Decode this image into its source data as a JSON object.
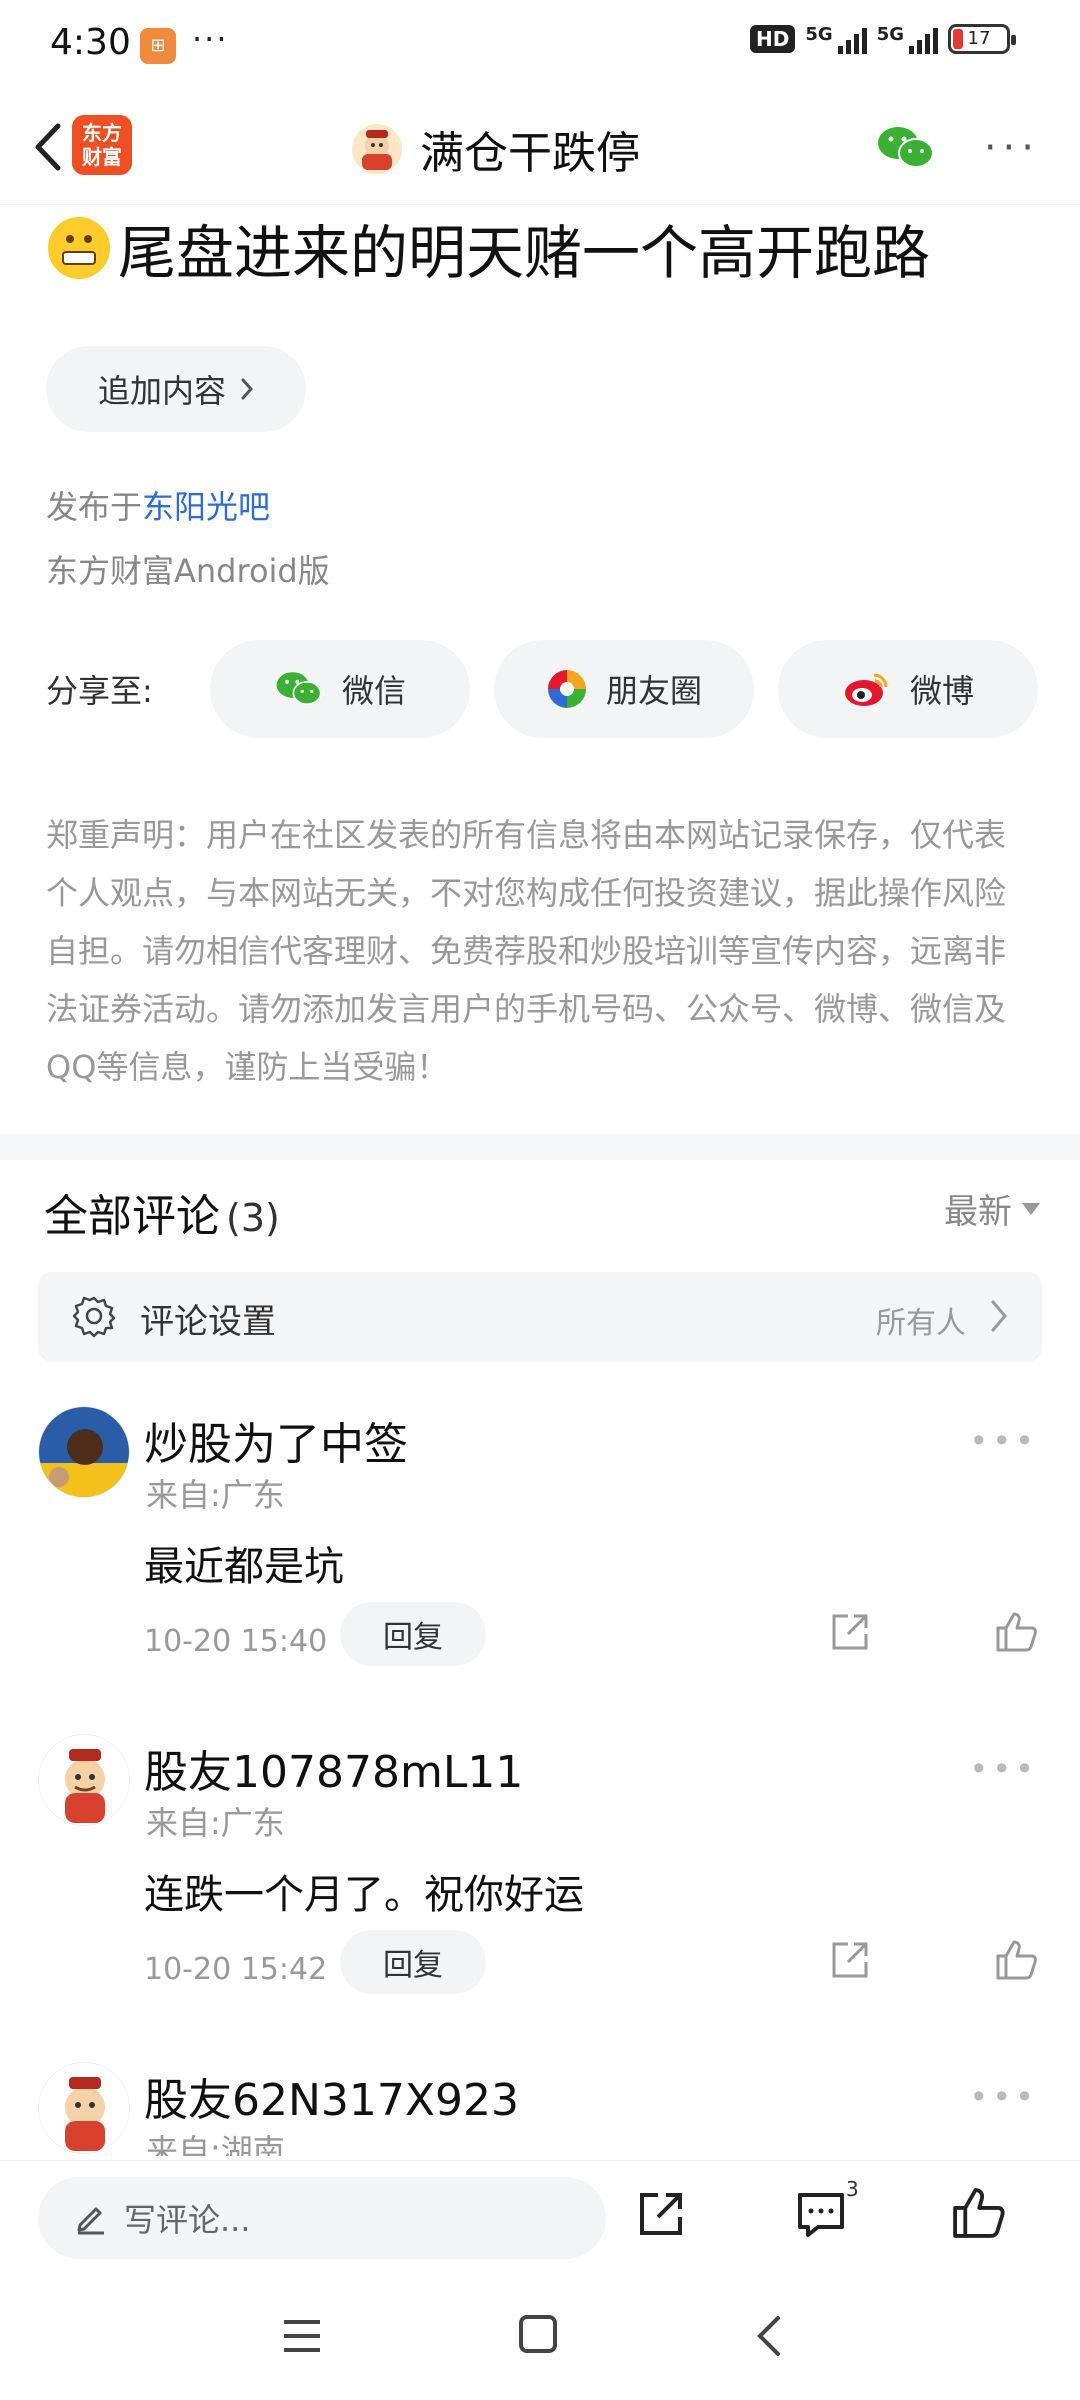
{
  "status_bar": {
    "time": "4:30",
    "app_badge": "⊞",
    "dots": "···",
    "hd": "HD",
    "net1": "5G",
    "net2": "5G",
    "battery": "17"
  },
  "nav": {
    "logo_line1": "东方",
    "logo_line2": "财富",
    "title": "满仓干跌停",
    "more": "···"
  },
  "post": {
    "title": "尾盘进来的明天赌一个高开跑路",
    "append_button": "追加内容",
    "published_prefix": "发布于",
    "published_board": "东阳光吧",
    "client": "东方财富Android版",
    "share_label": "分享至:",
    "share_options": [
      "微信",
      "朋友圈",
      "微博"
    ],
    "disclaimer": "郑重声明：用户在社区发表的所有信息将由本网站记录保存，仅代表个人观点，与本网站无关，不对您构成任何投资建议，据此操作风险自担。请勿相信代客理财、免费荐股和炒股培训等宣传内容，远离非法证券活动。请勿添加发言用户的手机号码、公众号、微博、微信及QQ等信息，谨防上当受骗！"
  },
  "comments": {
    "header": "全部评论",
    "count": "(3)",
    "sort": "最新",
    "settings_label": "评论设置",
    "settings_value": "所有人",
    "reply_label": "回复",
    "items": [
      {
        "name": "炒股为了中签",
        "from": "来自:广东",
        "text": "最近都是坑",
        "time": "10-20 15:40"
      },
      {
        "name": "股友107878mL11",
        "from": "来自:广东",
        "text": "连跌一个月了。祝你好运",
        "time": "10-20 15:42"
      },
      {
        "name": "股友62N317X923",
        "from": "来自:湖南",
        "text": "",
        "time": ""
      }
    ]
  },
  "bottom_bar": {
    "input_placeholder": "写评论...",
    "comment_badge": "3"
  },
  "colors": {
    "accent_blue": "#2f6bd6",
    "brand_orange": "#f04e23",
    "wechat_green": "#3cb034",
    "weibo_red": "#e6162d"
  }
}
